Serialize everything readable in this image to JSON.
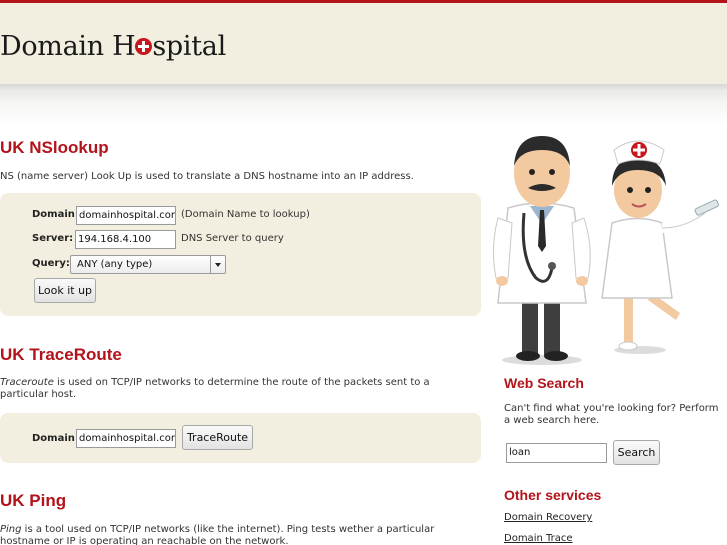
{
  "brand": {
    "name_before": "Domain H",
    "name_after": "spital"
  },
  "nslookup": {
    "heading": "UK NSlookup",
    "description": "NS (name server) Look Up is used to translate a DNS hostname into an IP address.",
    "domain_label": "Domain",
    "domain_value": "domainhospital.com",
    "domain_hint": "(Domain Name to lookup)",
    "server_label": "Server:",
    "server_value": "194.168.4.100",
    "server_hint": "DNS Server to query",
    "query_label": "Query:",
    "query_value": "ANY (any type)",
    "submit_label": "Look it up"
  },
  "traceroute": {
    "heading": "UK TraceRoute",
    "desc_term": "Traceroute",
    "desc_rest": " is used on TCP/IP networks to determine the route of the packets sent to a particular host.",
    "domain_label": "Domain",
    "domain_value": "domainhospital.com",
    "submit_label": "TraceRoute"
  },
  "ping": {
    "heading": "UK Ping",
    "desc_term": "Ping",
    "desc_rest": " is a tool used on TCP/IP networks (like the internet). Ping tests wether a particular hostname or IP is operating an reachable on the network."
  },
  "web_search": {
    "heading": "Web Search",
    "description": "Can't find what you're looking for? Perform a web search here.",
    "input_value": "loan",
    "button_label": "Search"
  },
  "other_services": {
    "heading": "Other services",
    "links": [
      "Domain Recovery",
      "Domain Trace"
    ]
  },
  "colors": {
    "accent": "#b3131b",
    "panel": "#f3efe0"
  },
  "illustration": "doctor-and-nurse-illustration"
}
